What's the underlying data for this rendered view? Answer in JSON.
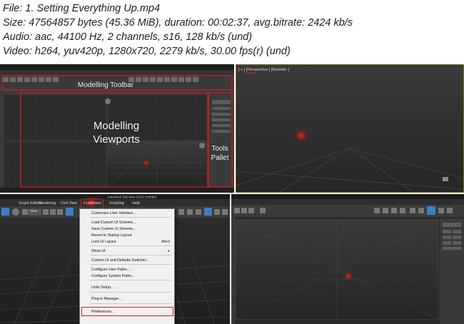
{
  "info": {
    "file": "File: 1. Setting Everything Up.mp4",
    "size": "Size: 47564857 bytes (45.36 MiB), duration: 00:02:37, avg.bitrate: 2424 kb/s",
    "audio": "Audio: aac, 44100 Hz, 2 channels, s16, 128 kb/s (und)",
    "video": "Video: h264, yuv420p, 1280x720, 2279 kb/s, 30.00 fps(r) (und)"
  },
  "frame1": {
    "toolbar_label": "Modelling Toolbar",
    "viewports_label_1": "Modelling",
    "viewports_label_2": "Viewports",
    "tools_label_1": "Tools",
    "tools_label_2": "Pallet"
  },
  "frame2": {
    "viewport_label": "[ + ] [Perspective ] [Realistic ]"
  },
  "frame3": {
    "app_title": "Autodesk 3ds Max 2016    Untitled",
    "menubar": [
      "Graph Editors",
      "Rendering",
      "Civil View",
      "Customize",
      "Scripting",
      "Help"
    ],
    "selection_dropdown": "View",
    "menu": {
      "items": [
        {
          "label": "Customize User Interface...",
          "shortcut": ""
        },
        {
          "label": "Load Custom UI Scheme...",
          "shortcut": ""
        },
        {
          "label": "Save Custom UI Scheme...",
          "shortcut": ""
        },
        {
          "label": "Revert to Startup Layout",
          "shortcut": ""
        },
        {
          "label": "Lock UI Layout",
          "shortcut": "Alt+0"
        },
        {
          "label": "Show UI",
          "shortcut": "▸"
        },
        {
          "label": "Custom UI and Defaults Switcher...",
          "shortcut": ""
        },
        {
          "label": "Configure User Paths...",
          "shortcut": ""
        },
        {
          "label": "Configure System Paths...",
          "shortcut": ""
        },
        {
          "label": "Units Setup...",
          "shortcut": ""
        },
        {
          "label": "Plug-in Manager...",
          "shortcut": ""
        },
        {
          "label": "Preferences...",
          "shortcut": ""
        }
      ]
    }
  },
  "colors": {
    "highlight_red": "#d01f1f",
    "viewport_bg": "#2b2b2b",
    "menu_bg": "#f0f0f0",
    "toolbar_blue": "#3b7fc4"
  }
}
